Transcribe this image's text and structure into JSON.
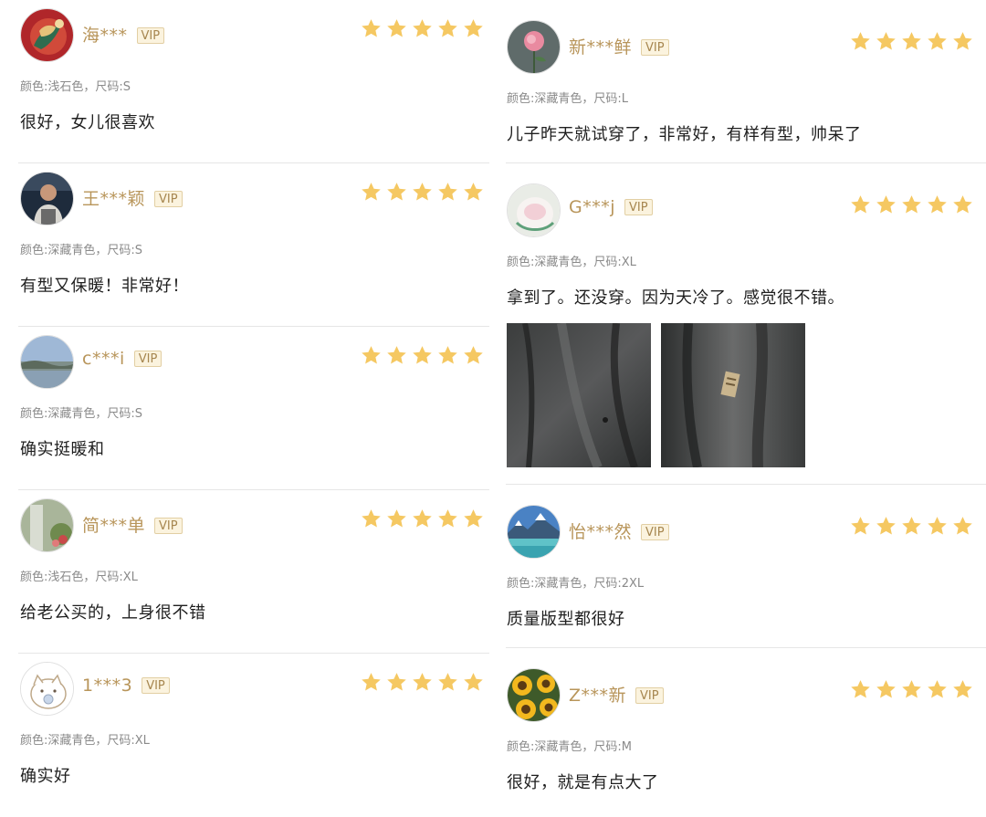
{
  "colors": {
    "star": "#f5c862",
    "username": "#b8955a",
    "vip_text": "#a6864f",
    "vip_bg": "#fbf3de",
    "spec": "#8a8a8a",
    "divider": "#e6e6e6"
  },
  "left_reviews": [
    {
      "username": "海***",
      "badge": "VIP",
      "rating": 5,
      "spec": "颜色:浅石色，尺码:S",
      "comment": "很好，女儿很喜欢",
      "avatar": "avatar-ornament"
    },
    {
      "username": "王***颖",
      "badge": "VIP",
      "rating": 5,
      "spec": "颜色:深藏青色，尺码:S",
      "comment": "有型又保暖！非常好！",
      "avatar": "avatar-person"
    },
    {
      "username": "c***i",
      "badge": "VIP",
      "rating": 5,
      "spec": "颜色:深藏青色，尺码:S",
      "comment": "确实挺暖和",
      "avatar": "avatar-landscape"
    },
    {
      "username": "简***单",
      "badge": "VIP",
      "rating": 5,
      "spec": "颜色:浅石色，尺码:XL",
      "comment": "给老公买的，上身很不错",
      "avatar": "avatar-garden"
    },
    {
      "username": "1***3",
      "badge": "VIP",
      "rating": 5,
      "spec": "颜色:深藏青色，尺码:XL",
      "comment": "确实好",
      "avatar": "avatar-cartoon-cat"
    }
  ],
  "right_reviews": [
    {
      "username": "新***鲜",
      "badge": "VIP",
      "rating": 5,
      "spec": "颜色:深藏青色，尺码:L",
      "comment": "儿子昨天就试穿了，非常好，有样有型，帅呆了",
      "avatar": "avatar-rose"
    },
    {
      "username": "G***j",
      "badge": "VIP",
      "rating": 5,
      "spec": "颜色:深藏青色，尺码:XL",
      "comment": "拿到了。还没穿。因为天冷了。感觉很不错。",
      "avatar": "avatar-pink-bowl",
      "photos": [
        "jacket-photo-front",
        "jacket-photo-label"
      ]
    },
    {
      "username": "怡***然",
      "badge": "VIP",
      "rating": 5,
      "spec": "颜色:深藏青色，尺码:2XL",
      "comment": "质量版型都很好",
      "avatar": "avatar-lake"
    },
    {
      "username": "Z***新",
      "badge": "VIP",
      "rating": 5,
      "spec": "颜色:深藏青色，尺码:M",
      "comment": "很好，就是有点大了",
      "avatar": "avatar-sunflowers"
    }
  ]
}
